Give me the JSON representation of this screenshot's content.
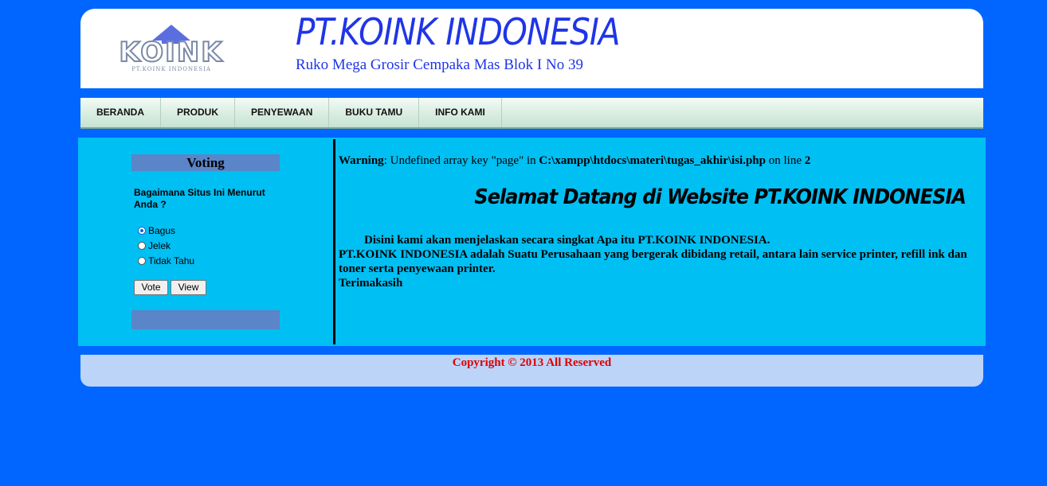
{
  "header": {
    "logo_text": "KOINK",
    "logo_subtext": "PT.KOINK INDONESIA",
    "title": "PT.KOINK INDONESIA",
    "address": "Ruko Mega Grosir Cempaka Mas Blok I No 39"
  },
  "nav": {
    "items": [
      {
        "label": "BERANDA"
      },
      {
        "label": "PRODUK"
      },
      {
        "label": "PENYEWAAN"
      },
      {
        "label": "BUKU TAMU"
      },
      {
        "label": "INFO KAMI"
      }
    ]
  },
  "voting": {
    "title": "Voting",
    "question": "Bagaimana Situs Ini Menurut Anda ?",
    "options": [
      {
        "label": "Bagus",
        "checked": true
      },
      {
        "label": "Jelek",
        "checked": false
      },
      {
        "label": "Tidak Tahu",
        "checked": false
      }
    ],
    "vote_button": "Vote",
    "view_button": "View"
  },
  "main": {
    "warning_label": "Warning",
    "warning_text": ": Undefined array key \"page\" in ",
    "warning_file": "C:\\xampp\\htdocs\\materi\\tugas_akhir\\isi.php",
    "warning_online": " on line ",
    "warning_line": "2",
    "welcome": "Selamat Datang di Website PT.KOINK INDONESIA",
    "intro": "Disini kami akan menjelaskan secara singkat Apa itu PT.KOINK INDONESIA.",
    "description": "PT.KOINK INDONESIA adalah Suatu Perusahaan yang bergerak dibidang retail, antara lain service printer, refill ink dan toner serta penyewaan printer.",
    "closing": "Terimakasih"
  },
  "footer": {
    "copyright": "Copyright © 2013 All Reserved"
  }
}
